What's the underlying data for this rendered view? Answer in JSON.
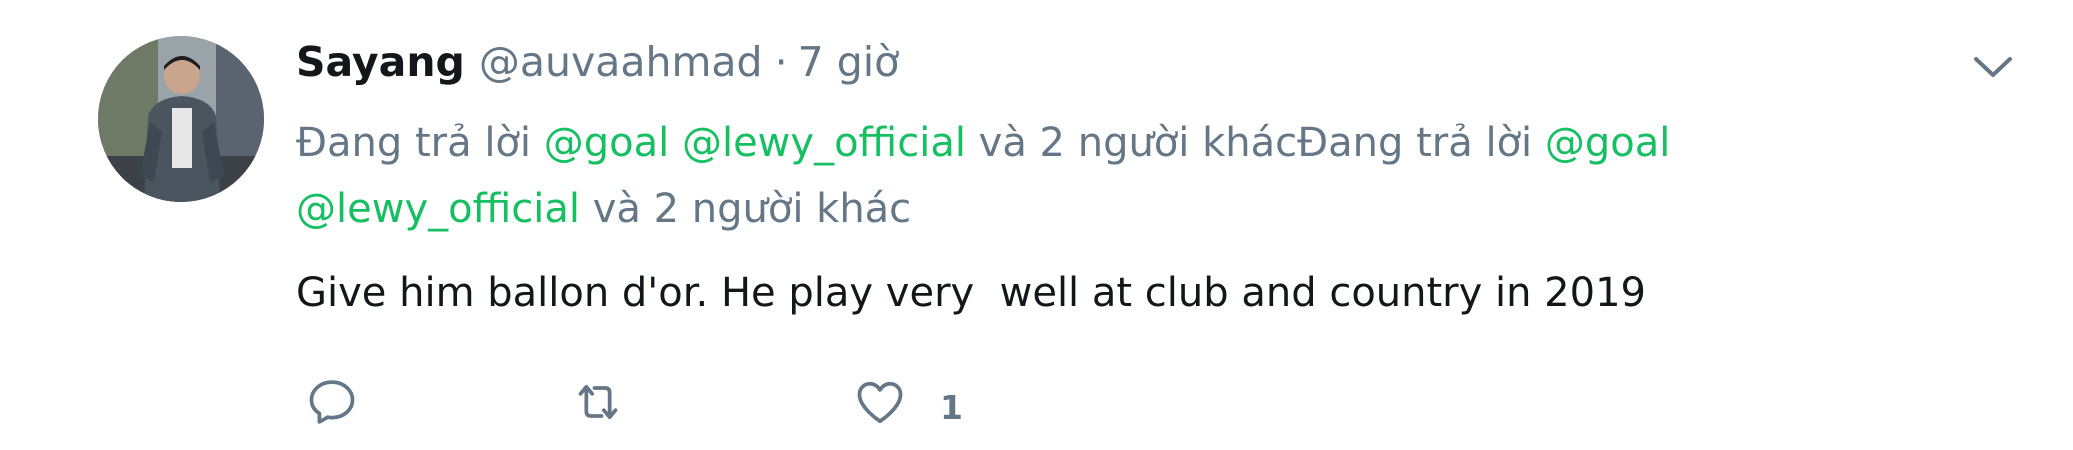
{
  "tweet": {
    "display_name": "Sayang",
    "handle": "@auvaahmad",
    "separator": "·",
    "time": "7 giờ",
    "reply_context": {
      "prefix_1": "Đang trả lời ",
      "mention_1": "@goal",
      "mention_2": "@lewy_official",
      "suffix_1": " và 2 người khác",
      "prefix_2": "Đang trả lời ",
      "mention_3": "@goal",
      "mention_4": "@lewy_official",
      "suffix_2": " và 2 người khác"
    },
    "text": "Give him ballon d'or. He play very  well at club and country in 2019",
    "actions": {
      "reply_icon": "reply-icon",
      "retweet_icon": "retweet-icon",
      "like_icon": "heart-icon",
      "like_count": "1"
    },
    "menu_icon": "chevron-down-icon"
  },
  "colors": {
    "text_primary": "#14171a",
    "text_secondary": "#657786",
    "mention": "#17bf63",
    "icon": "#657786"
  }
}
